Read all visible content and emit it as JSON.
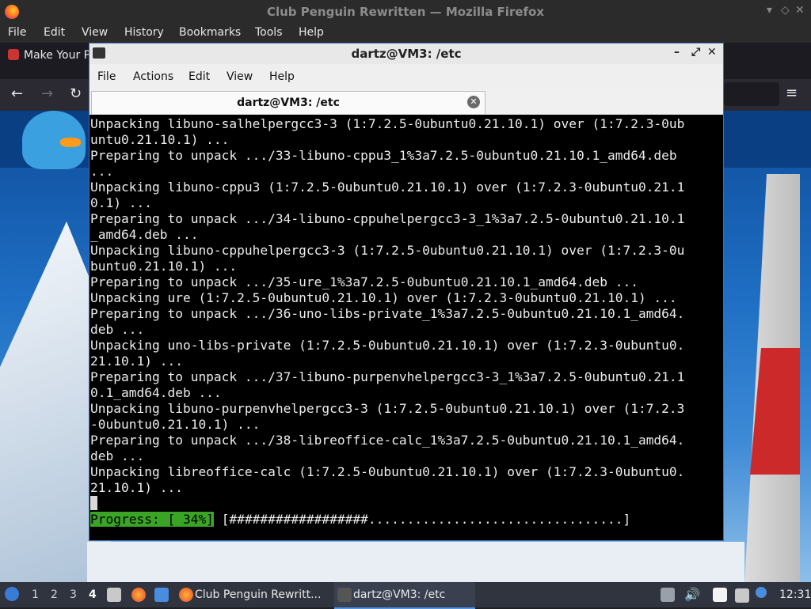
{
  "firefox": {
    "window_title": "Club Penguin Rewritten — Mozilla Firefox",
    "menu": [
      "File",
      "Edit",
      "View",
      "History",
      "Bookmarks",
      "Tools",
      "Help"
    ],
    "tab_label": "Make Your P"
  },
  "terminal": {
    "window_title": "dartz@VM3: /etc",
    "menu": [
      "File",
      "Actions",
      "Edit",
      "View",
      "Help"
    ],
    "tab_label": "dartz@VM3: /etc",
    "lines": [
      "Unpacking libuno-salhelpergcc3-3 (1:7.2.5-0ubuntu0.21.10.1) over (1:7.2.3-0ub",
      "untu0.21.10.1) ...",
      "Preparing to unpack .../33-libuno-cppu3_1%3a7.2.5-0ubuntu0.21.10.1_amd64.deb",
      "...",
      "Unpacking libuno-cppu3 (1:7.2.5-0ubuntu0.21.10.1) over (1:7.2.3-0ubuntu0.21.1",
      "0.1) ...",
      "Preparing to unpack .../34-libuno-cppuhelpergcc3-3_1%3a7.2.5-0ubuntu0.21.10.1",
      "_amd64.deb ...",
      "Unpacking libuno-cppuhelpergcc3-3 (1:7.2.5-0ubuntu0.21.10.1) over (1:7.2.3-0u",
      "buntu0.21.10.1) ...",
      "Preparing to unpack .../35-ure_1%3a7.2.5-0ubuntu0.21.10.1_amd64.deb ...",
      "Unpacking ure (1:7.2.5-0ubuntu0.21.10.1) over (1:7.2.3-0ubuntu0.21.10.1) ...",
      "Preparing to unpack .../36-uno-libs-private_1%3a7.2.5-0ubuntu0.21.10.1_amd64.",
      "deb ...",
      "Unpacking uno-libs-private (1:7.2.5-0ubuntu0.21.10.1) over (1:7.2.3-0ubuntu0.",
      "21.10.1) ...",
      "Preparing to unpack .../37-libuno-purpenvhelpergcc3-3_1%3a7.2.5-0ubuntu0.21.1",
      "0.1_amd64.deb ...",
      "Unpacking libuno-purpenvhelpergcc3-3 (1:7.2.5-0ubuntu0.21.10.1) over (1:7.2.3",
      "-0ubuntu0.21.10.1) ...",
      "Preparing to unpack .../38-libreoffice-calc_1%3a7.2.5-0ubuntu0.21.10.1_amd64.",
      "deb ...",
      "Unpacking libreoffice-calc (1:7.2.5-0ubuntu0.21.10.1) over (1:7.2.3-0ubuntu0.",
      "21.10.1) ..."
    ],
    "progress_label": "Progress: [ 34%]",
    "progress_bar": "[##################.................................]",
    "progress_percent": 34
  },
  "taskbar": {
    "workspaces": [
      "1",
      "2",
      "3",
      "4"
    ],
    "active_workspace": "4",
    "tasks": [
      {
        "label": "Club Penguin Rewritt..."
      },
      {
        "label": "dartz@VM3: /etc"
      }
    ],
    "clock": "12:31"
  }
}
